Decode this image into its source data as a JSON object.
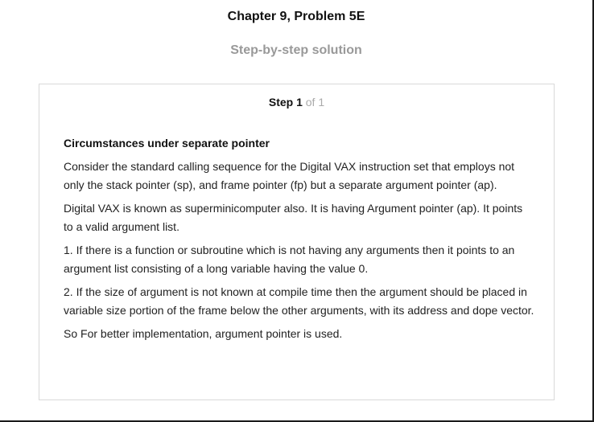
{
  "header": {
    "chapter_title": "Chapter 9, Problem 5E",
    "solution_title": "Step-by-step solution"
  },
  "step": {
    "label": "Step 1",
    "of_text": " of 1",
    "heading": "Circumstances under separate pointer",
    "paragraphs": [
      "Consider the standard calling sequence for the Digital VAX instruction set that employs not only the stack pointer (sp), and frame pointer (fp) but a separate argument pointer (ap).",
      "Digital VAX is known as superminicomputer also. It is having Argument pointer (ap). It points to a valid argument list.",
      "1. If there is a function or subroutine which is not having any arguments then it points to an argument list consisting of a long variable having the value 0.",
      "2. If the size of argument is not known at compile time then the argument should be placed in variable size portion of the frame below the other arguments, with its address and dope vector.",
      "So For better implementation, argument pointer is used."
    ]
  }
}
